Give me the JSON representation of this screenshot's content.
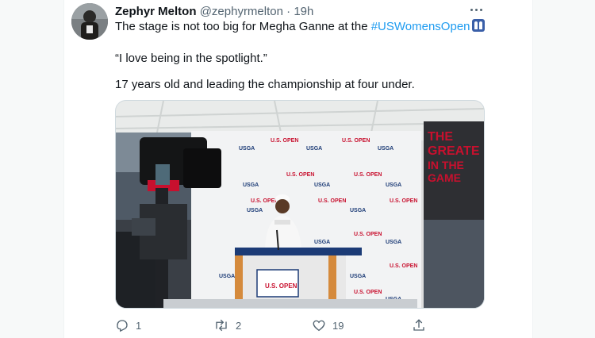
{
  "tweet": {
    "author_name": "Zephyr Melton",
    "author_handle": "@zephyrmelton",
    "separator": "·",
    "time": "19h",
    "line1_text": "The stage is not too big for Megha Ganne at the ",
    "hashtag": "#USWomensOpen",
    "line2": "“I love being in the spotlight.”",
    "line3": "17 years old and leading the championship at four under."
  },
  "media": {
    "sponsor_labels": [
      "U.S. OPEN",
      "USGA"
    ],
    "banner_text": [
      "THE",
      "GREATE",
      "IN THE",
      "GAME"
    ]
  },
  "actions": {
    "reply_count": "1",
    "retweet_count": "2",
    "like_count": "19"
  },
  "colors": {
    "link": "#1d9bf0",
    "secondary_text": "#536471",
    "usga_red": "#c8102e",
    "usga_blue": "#1c3b76"
  },
  "icons": [
    "more-icon",
    "reply-icon",
    "retweet-icon",
    "like-icon",
    "share-icon",
    "hashtag-emoji-icon"
  ]
}
